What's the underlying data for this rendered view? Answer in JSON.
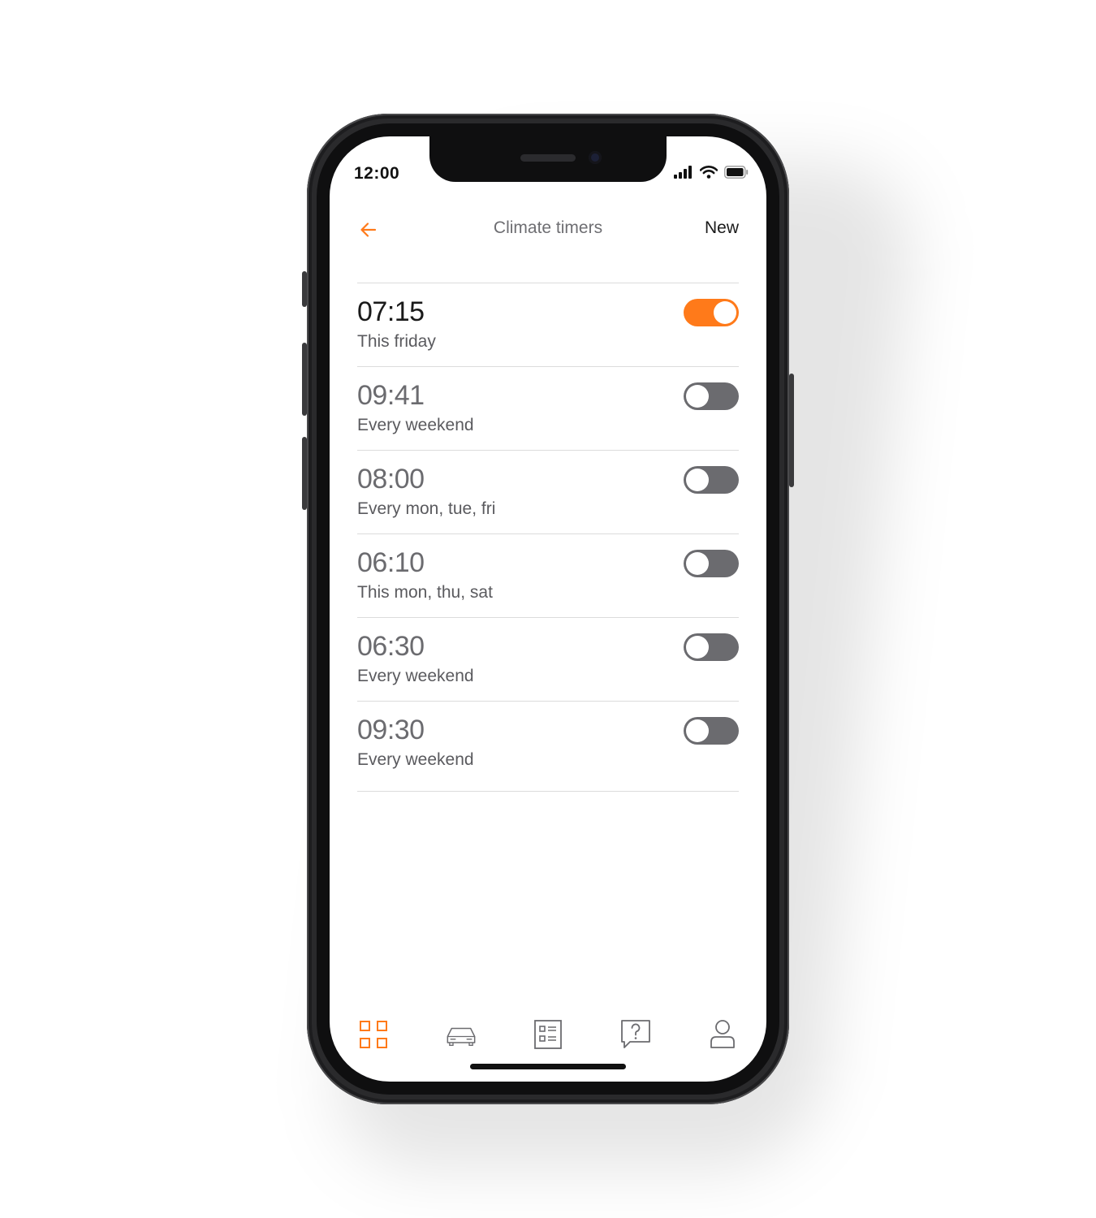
{
  "status_bar": {
    "time": "12:00"
  },
  "header": {
    "title": "Climate timers",
    "new_label": "New"
  },
  "timers": [
    {
      "time": "07:15",
      "repeat": "This friday",
      "enabled": true
    },
    {
      "time": "09:41",
      "repeat": "Every weekend",
      "enabled": false
    },
    {
      "time": "08:00",
      "repeat": "Every mon, tue, fri",
      "enabled": false
    },
    {
      "time": "06:10",
      "repeat": "This mon, thu, sat",
      "enabled": false
    },
    {
      "time": "06:30",
      "repeat": "Every weekend",
      "enabled": false
    },
    {
      "time": "09:30",
      "repeat": "Every weekend",
      "enabled": false
    }
  ],
  "tabbar": {
    "items": [
      {
        "icon": "grid-icon",
        "active": true
      },
      {
        "icon": "car-icon",
        "active": false
      },
      {
        "icon": "list-icon",
        "active": false
      },
      {
        "icon": "help-icon",
        "active": false
      },
      {
        "icon": "profile-icon",
        "active": false
      }
    ]
  },
  "colors": {
    "accent": "#ff7a1a",
    "toggle_off": "#6b6b6f",
    "icon_inactive": "#6b6b6f"
  }
}
